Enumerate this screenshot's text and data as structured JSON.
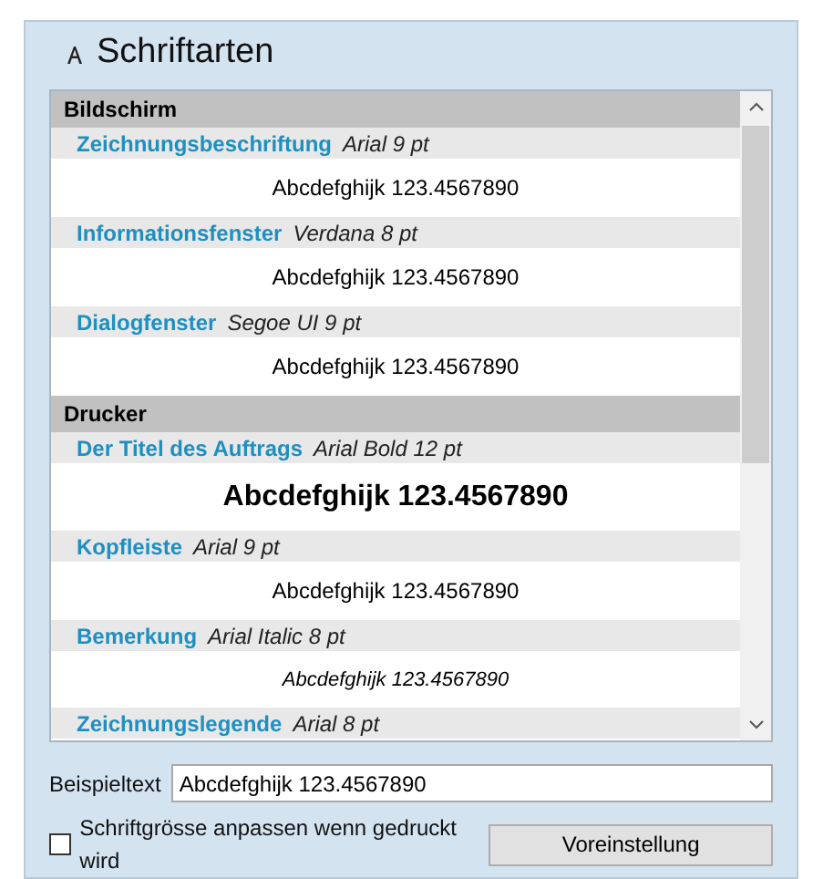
{
  "panel": {
    "title": "Schriftarten"
  },
  "sections": [
    {
      "name": "Bildschirm",
      "items": [
        {
          "label": "Zeichnungsbeschriftung",
          "font": "Arial 9 pt",
          "sample": "Abcdefghijk 123.4567890",
          "kind": "regular"
        },
        {
          "label": "Informationsfenster",
          "font": "Verdana 8 pt",
          "sample": "Abcdefghijk 123.4567890",
          "kind": "regular"
        },
        {
          "label": "Dialogfenster",
          "font": "Segoe UI 9 pt",
          "sample": "Abcdefghijk 123.4567890",
          "kind": "regular"
        }
      ]
    },
    {
      "name": "Drucker",
      "items": [
        {
          "label": "Der Titel des Auftrags",
          "font": "Arial Bold 12 pt",
          "sample": "Abcdefghijk 123.4567890",
          "kind": "heading"
        },
        {
          "label": "Kopfleiste",
          "font": "Arial 9 pt",
          "sample": "Abcdefghijk 123.4567890",
          "kind": "regular"
        },
        {
          "label": "Bemerkung",
          "font": "Arial Italic 8 pt",
          "sample": "Abcdefghijk 123.4567890",
          "kind": "italic"
        },
        {
          "label": "Zeichnungslegende",
          "font": "Arial 8 pt"
        }
      ]
    }
  ],
  "sample_text": {
    "label": "Beispieltext",
    "value": "Abcdefghijk 123.4567890"
  },
  "scale_checkbox": {
    "label": "Schriftgrösse anpassen wenn gedruckt wird",
    "checked": false
  },
  "default_button": "Voreinstellung"
}
